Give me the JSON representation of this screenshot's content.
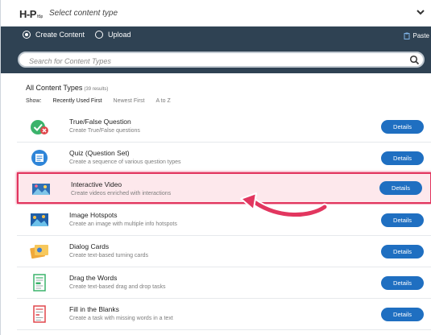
{
  "selector": {
    "logo": "H-P",
    "logo_suffix": "h5p",
    "label": "Select content type"
  },
  "tabs": {
    "create": "Create Content",
    "upload": "Upload",
    "paste": "Paste"
  },
  "search": {
    "placeholder": "Search for Content Types"
  },
  "content_types": {
    "title": "All Content Types",
    "count": "(39 results)",
    "show_label": "Show:",
    "sort_options": [
      "Recently Used First",
      "Newest First",
      "A to Z"
    ]
  },
  "details_label": "Details",
  "items": [
    {
      "name": "True/False Question",
      "desc": "Create True/False questions",
      "icon": "true-false-icon"
    },
    {
      "name": "Quiz (Question Set)",
      "desc": "Create a sequence of various question types",
      "icon": "quiz-icon"
    },
    {
      "name": "Interactive Video",
      "desc": "Create videos enriched with interactions",
      "icon": "interactive-video-icon",
      "highlighted": true
    },
    {
      "name": "Image Hotspots",
      "desc": "Create an image with multiple info hotspots",
      "icon": "image-hotspots-icon"
    },
    {
      "name": "Dialog Cards",
      "desc": "Create text-based turning cards",
      "icon": "dialog-cards-icon"
    },
    {
      "name": "Drag the Words",
      "desc": "Create text-based drag and drop tasks",
      "icon": "drag-words-icon"
    },
    {
      "name": "Fill in the Blanks",
      "desc": "Create a task with missing words in a text",
      "icon": "fill-blanks-icon"
    }
  ],
  "colors": {
    "header": "#2f4253",
    "button": "#1f6fc1",
    "highlight_border": "#e2365f",
    "highlight_bg": "#fde8ec"
  }
}
